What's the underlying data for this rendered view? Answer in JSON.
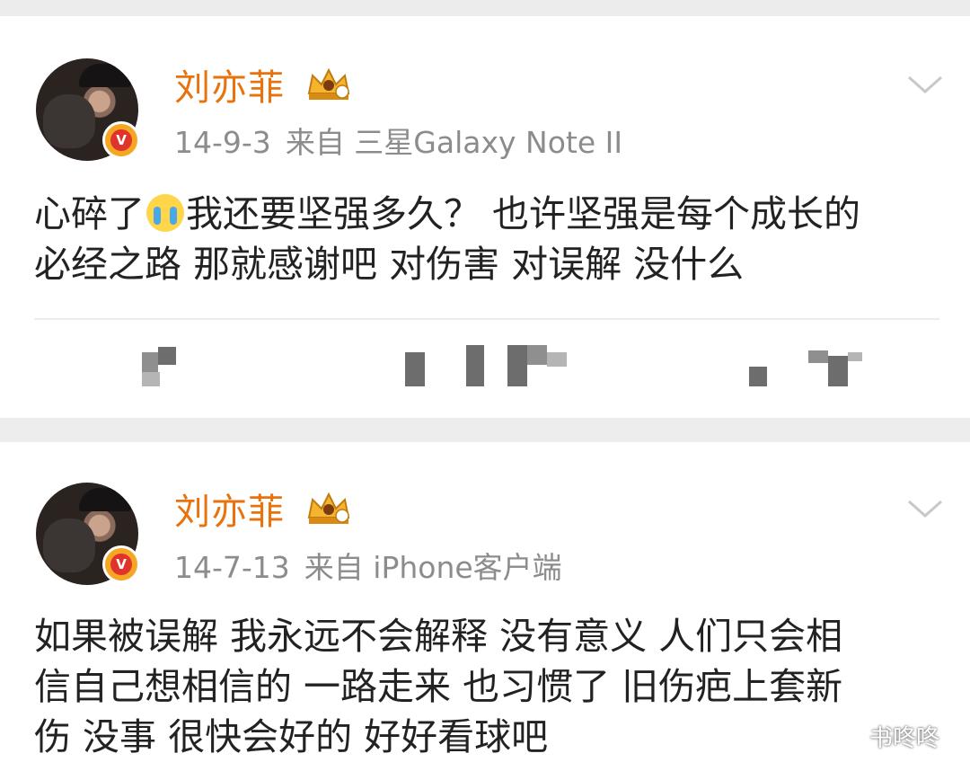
{
  "posts": [
    {
      "username": "刘亦菲",
      "date": "14-9-3",
      "source": "来自 三星Galaxy Note II",
      "content_before_emoji": "心碎了",
      "emoji": "crying-face",
      "content_after_emoji": "我还要坚强多久？ 也许坚强是每个成长的\n必经之路 那就感谢吧 对伤害 对误解 没什么"
    },
    {
      "username": "刘亦菲",
      "date": "14-7-13",
      "source": "来自 iPhone客户端",
      "content": "如果被误解 我永远不会解释 没有意义 人们只会相\n信自己想相信的 一路走来 也习惯了 旧伤疤上套新\n伤 没事 很快会好的 好好看球吧"
    }
  ],
  "watermark": {
    "text": "书咚咚",
    "icon": "wechat-icon"
  },
  "icons": {
    "verified": "verified-v-badge-icon",
    "member": "crown-level-icon",
    "expand": "chevron-down-icon"
  },
  "colors": {
    "username": "#e8720c",
    "meta": "#8c8c8c",
    "verified_badge": "#e0332b",
    "crown": "#f5a623"
  }
}
